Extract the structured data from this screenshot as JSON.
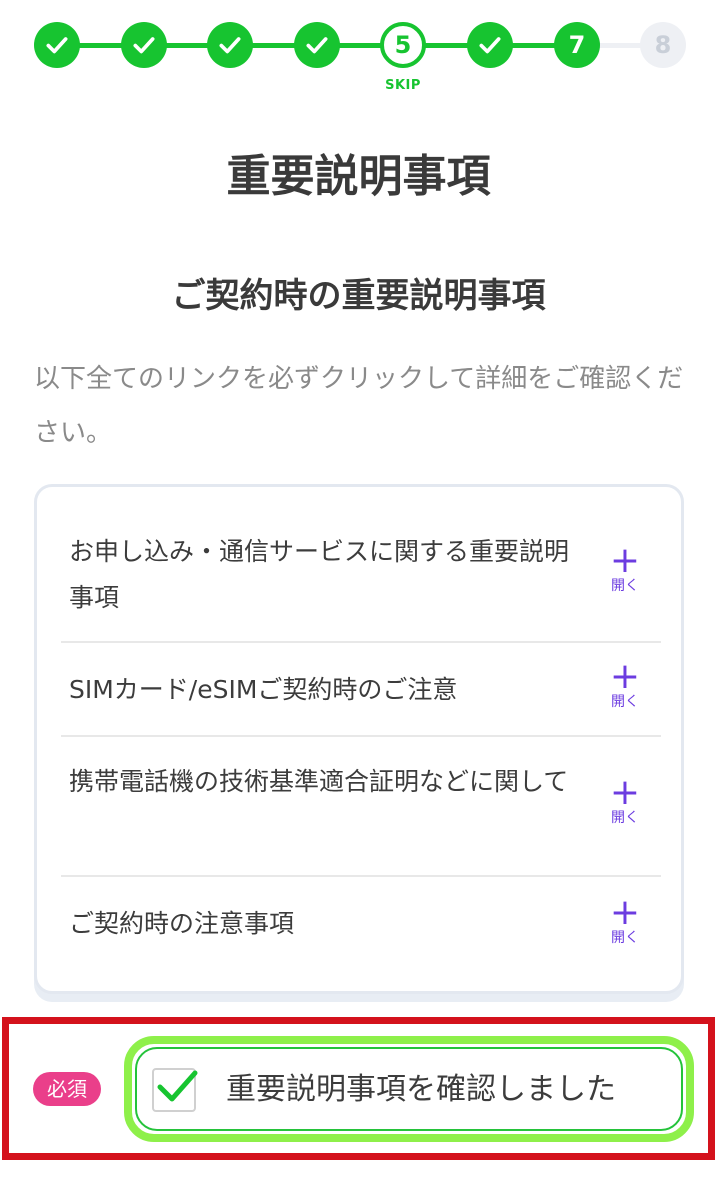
{
  "stepper": {
    "steps": [
      {
        "label": "",
        "state": "done"
      },
      {
        "label": "",
        "state": "done"
      },
      {
        "label": "",
        "state": "done"
      },
      {
        "label": "",
        "state": "done"
      },
      {
        "label": "5",
        "state": "current"
      },
      {
        "label": "",
        "state": "done"
      },
      {
        "label": "7",
        "state": "active"
      },
      {
        "label": "8",
        "state": "todo"
      }
    ],
    "skip_label": "SKIP",
    "colors": {
      "accent": "#17c430",
      "inactive": "#eef0f4"
    }
  },
  "page_title": "重要説明事項",
  "section_title": "ご契約時の重要説明事項",
  "instruction": "以下全てのリンクを必ずクリックして詳細をご確認ください。",
  "items": [
    {
      "text": "お申し込み・通信サービスに関する重要説明事項",
      "toggle_label": "開く",
      "icon": "plus-icon"
    },
    {
      "text": "SIMカード/eSIMご契約時のご注意",
      "toggle_label": "開く",
      "icon": "plus-icon"
    },
    {
      "text": "携帯電話機の技術基準適合証明などに関して",
      "toggle_label": "開く",
      "icon": "plus-icon"
    },
    {
      "text": "ご契約時の注意事項",
      "toggle_label": "開く",
      "icon": "plus-icon"
    }
  ],
  "confirm": {
    "required_badge": "必須",
    "label": "重要説明事項を確認しました",
    "checked": true,
    "colors": {
      "badge": "#ea3f8a",
      "highlight_outer": "#d4121c",
      "highlight_inner": "#8ef04a",
      "check": "#17c430"
    }
  }
}
